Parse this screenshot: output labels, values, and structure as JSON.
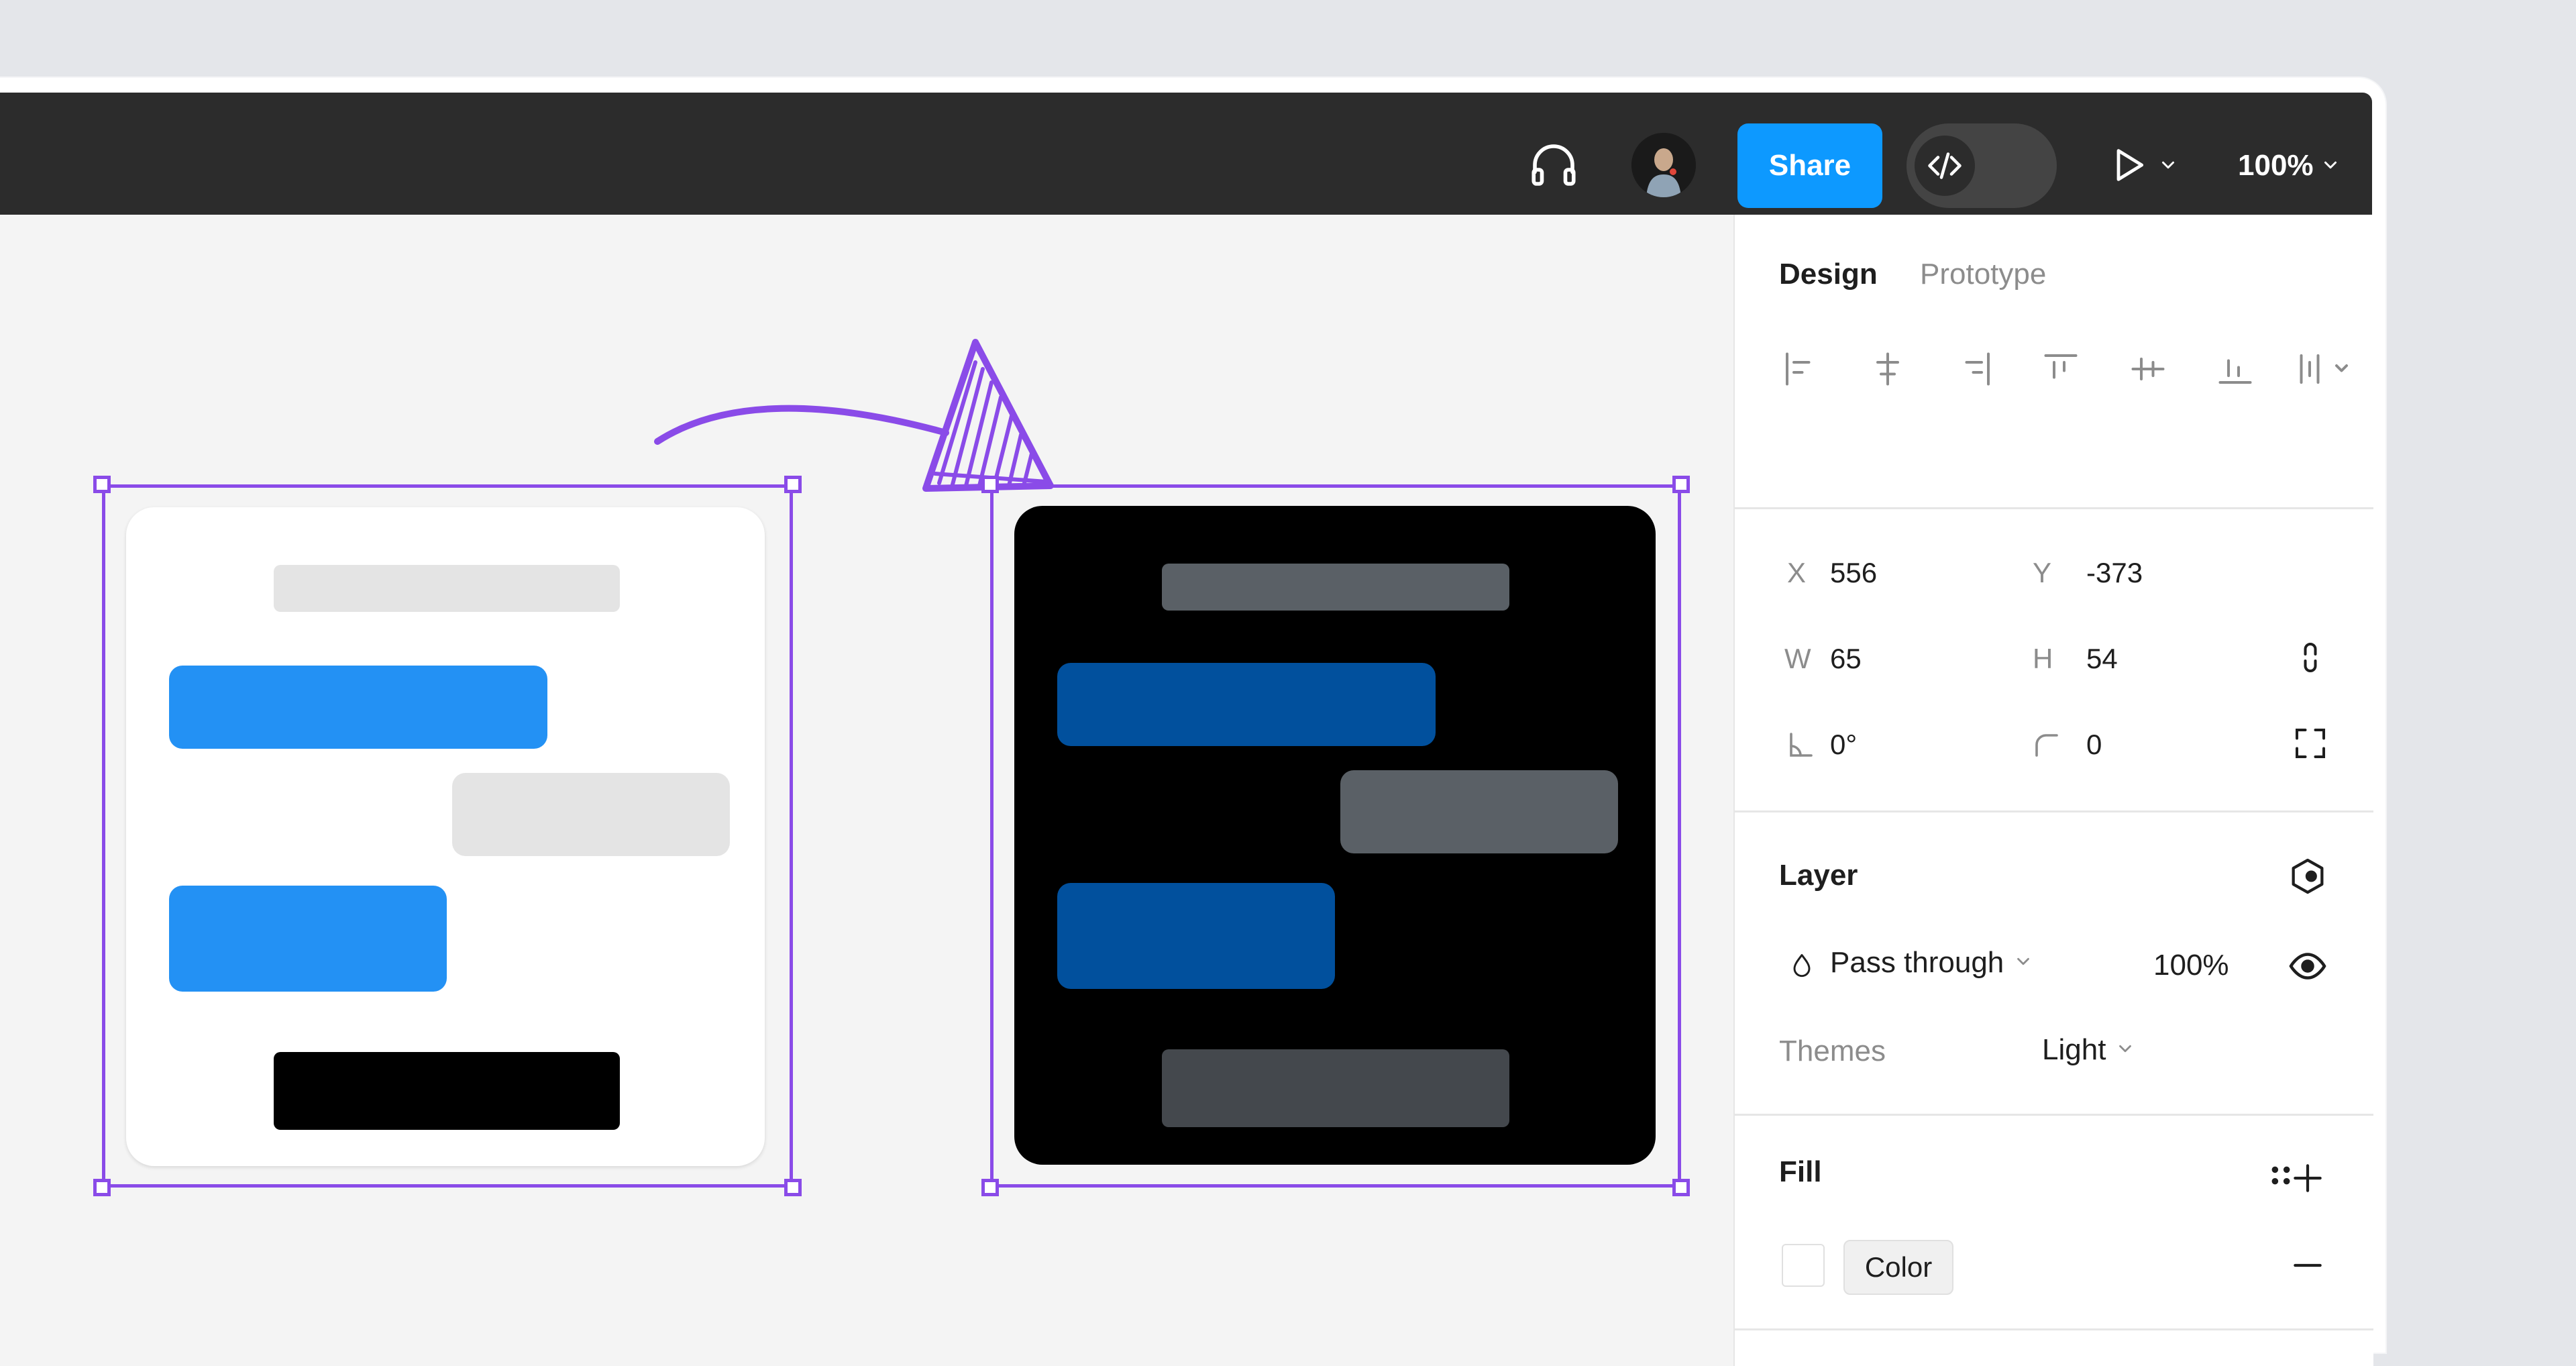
{
  "toolbar": {
    "share_label": "Share",
    "zoom_label": "100%",
    "icons": {
      "audio": "headphones-icon",
      "devmode": "code-icon",
      "play": "play-icon",
      "play_menu": "chevron-down-icon",
      "zoom_menu": "chevron-down-icon"
    }
  },
  "panel": {
    "tabs": [
      {
        "label": "Design",
        "active": true
      },
      {
        "label": "Prototype",
        "active": false
      }
    ],
    "position": {
      "x_label": "X",
      "x_value": "556",
      "y_label": "Y",
      "y_value": "-373",
      "w_label": "W",
      "w_value": "65",
      "h_label": "H",
      "h_value": "54",
      "rotation_value": "0°",
      "radius_value": "0"
    },
    "layer": {
      "title": "Layer",
      "blend_mode": "Pass through",
      "opacity": "100%",
      "themes_label": "Themes",
      "themes_value": "Light"
    },
    "fill": {
      "title": "Fill",
      "type_label": "Color",
      "swatch_color": "#ffffff"
    }
  },
  "canvas": {
    "colors": {
      "selection": "#8a4be8",
      "light_blue": "#2391f4",
      "light_gray": "#e4e4e4",
      "dark_blue": "#01509d",
      "dark_gray": "#5a6066"
    }
  }
}
